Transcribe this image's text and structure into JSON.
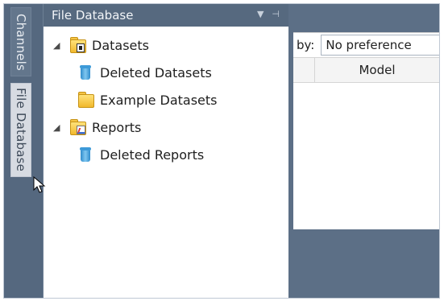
{
  "side_tabs": [
    {
      "label": "Channels"
    },
    {
      "label": "File Database"
    }
  ],
  "panel": {
    "title": "File Database",
    "controls": {
      "dropdown_icon": "chevron-down-icon",
      "pin_icon": "pin-icon"
    },
    "tree": [
      {
        "label": "Datasets",
        "icon": "datasets-folder-icon",
        "expander": "◢"
      },
      {
        "label": "Deleted Datasets",
        "icon": "trash-icon"
      },
      {
        "label": "Example Datasets",
        "icon": "folder-icon"
      },
      {
        "label": "Reports",
        "icon": "reports-folder-icon",
        "expander": "◢"
      },
      {
        "label": "Deleted Reports",
        "icon": "trash-icon"
      }
    ]
  },
  "main": {
    "filter_label": "by:",
    "filter_value": "No preference",
    "column_header": "Model"
  },
  "colors": {
    "background_dark": "#5c6f86",
    "panel_header": "#56697f",
    "active_tab": "#d7dbe2"
  }
}
